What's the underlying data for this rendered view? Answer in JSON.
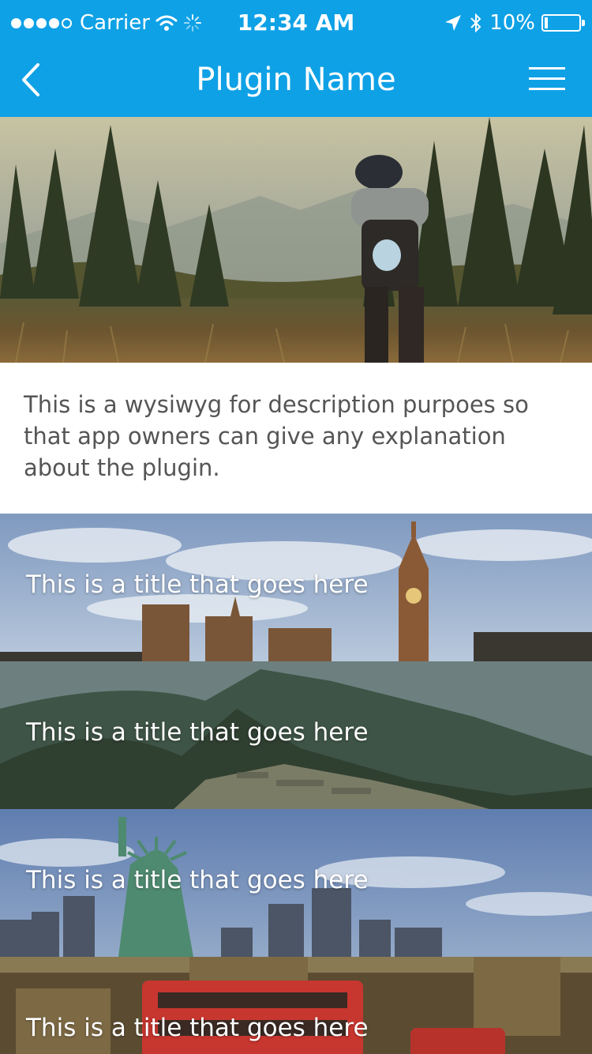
{
  "status_bar": {
    "carrier": "Carrier",
    "time": "12:34 AM",
    "battery": "10%",
    "battery_level": 0.1
  },
  "nav": {
    "title": "Plugin Name",
    "back_icon": "chevron-left-icon",
    "menu_icon": "hamburger-menu-icon"
  },
  "description": "This is a wysiwyg for description purpoes so that app owners can give any explanation about the plugin.",
  "items": [
    {
      "title": "This is a title that goes here"
    },
    {
      "title": "This is a title that goes here"
    },
    {
      "title": "This is a title that goes here"
    },
    {
      "title": "This is a title that goes here"
    }
  ],
  "colors": {
    "header_bg": "#0ea1e6",
    "text_on_header": "#ffffff",
    "description_text": "#555555"
  }
}
